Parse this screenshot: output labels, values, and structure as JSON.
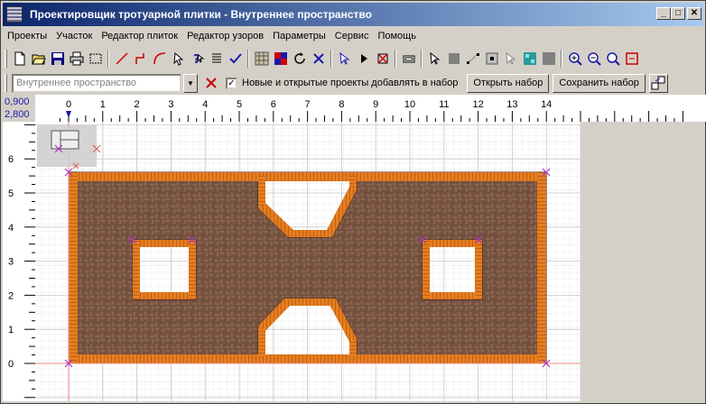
{
  "window": {
    "title": "Проектировщик тротуарной плитки - Внутреннее пространство",
    "minimize_glyph": "_",
    "maximize_glyph": "□",
    "close_glyph": "✕"
  },
  "menu": [
    "Проекты",
    "Участок",
    "Редактор плиток",
    "Редактор узоров",
    "Параметры",
    "Сервис",
    "Помощь"
  ],
  "toolbar1": {
    "icons": [
      "new-file-icon",
      "open-folder-icon",
      "save-icon",
      "print-icon",
      "select-rect-icon",
      "line-tool-icon",
      "polyline-tool-icon",
      "arc-tool-icon",
      "select-pointer-icon",
      "help-pointer-icon",
      "list-icon",
      "check-icon",
      "pattern-grid-icon",
      "color-tile-icon",
      "rotate-icon",
      "delete-x-icon",
      "pointer-arrow-icon",
      "play-icon",
      "stop-icon",
      "eraser-icon",
      "edit-node-icon",
      "fill-square-icon",
      "move-nodes-icon",
      "square-node-icon",
      "edit-pointer-icon",
      "texture-icon",
      "gray-square-icon",
      "zoom-in-icon",
      "zoom-out-icon",
      "zoom-fit-icon",
      "zoom-area-icon"
    ]
  },
  "toolbar2": {
    "project_combo_value": "Внутреннее пространство",
    "add_to_set_checked": true,
    "add_to_set_label": "Новые и открытые проекты добавлять в набор",
    "open_set_label": "Открыть набор",
    "save_set_label": "Сохранить набор"
  },
  "coords": {
    "x": "0,900",
    "y": "2,800"
  },
  "ruler": {
    "h_labels": [
      "0",
      "1",
      "2",
      "3",
      "4",
      "5",
      "6",
      "7",
      "8",
      "9",
      "10",
      "11",
      "12",
      "13",
      "14"
    ],
    "v_labels": [
      "6",
      "5",
      "4",
      "3",
      "2",
      "1",
      "0"
    ]
  },
  "colors": {
    "accent_blue": "#0a246a",
    "brick_orange": "#e87d1e",
    "brick_dark": "#5a3a2a",
    "node_marker": "#aa33cc"
  }
}
